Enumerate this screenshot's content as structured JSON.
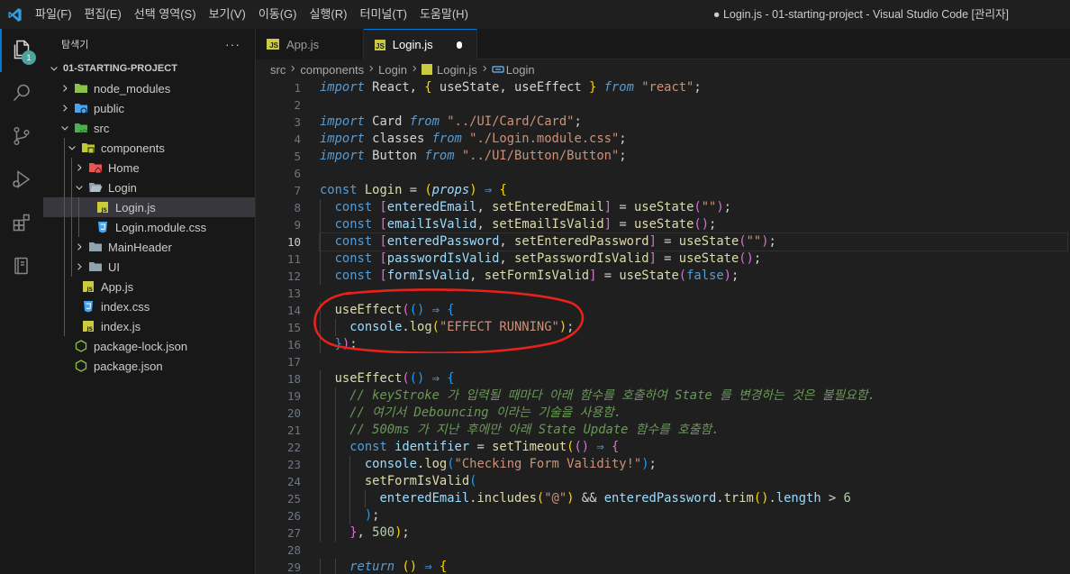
{
  "titlebar": {
    "menu": [
      "파일(F)",
      "편집(E)",
      "선택 영역(S)",
      "보기(V)",
      "이동(G)",
      "실행(R)",
      "터미널(T)",
      "도움말(H)"
    ],
    "window_title": "● Login.js - 01-starting-project - Visual Studio Code [관리자]"
  },
  "activity": {
    "explorer_badge": "1",
    "icons": [
      "files-icon",
      "search-icon",
      "source-control-icon",
      "run-debug-icon",
      "extensions-icon",
      "notebook-icon"
    ]
  },
  "sidebar": {
    "title": "탐색기",
    "more": "···",
    "project": "01-STARTING-PROJECT",
    "tree": [
      {
        "label": "node_modules",
        "type": "folder",
        "depth": 0,
        "open": false,
        "icon": "node-folder-icon"
      },
      {
        "label": "public",
        "type": "folder",
        "depth": 0,
        "open": false,
        "icon": "public-folder-icon"
      },
      {
        "label": "src",
        "type": "folder",
        "depth": 0,
        "open": true,
        "icon": "src-folder-icon"
      },
      {
        "label": "components",
        "type": "folder",
        "depth": 1,
        "open": true,
        "icon": "components-folder-icon"
      },
      {
        "label": "Home",
        "type": "folder",
        "depth": 2,
        "open": false,
        "icon": "home-folder-icon"
      },
      {
        "label": "Login",
        "type": "folder",
        "depth": 2,
        "open": true,
        "icon": "folder-icon"
      },
      {
        "label": "Login.js",
        "type": "js",
        "depth": 3,
        "selected": true,
        "icon": "js-file-icon"
      },
      {
        "label": "Login.module.css",
        "type": "css",
        "depth": 3,
        "icon": "css-file-icon"
      },
      {
        "label": "MainHeader",
        "type": "folder",
        "depth": 2,
        "open": false,
        "icon": "folder-icon"
      },
      {
        "label": "UI",
        "type": "folder",
        "depth": 2,
        "open": false,
        "icon": "folder-icon"
      },
      {
        "label": "App.js",
        "type": "js",
        "depth": 1,
        "icon": "js-file-icon"
      },
      {
        "label": "index.css",
        "type": "css",
        "depth": 1,
        "icon": "css-file-icon"
      },
      {
        "label": "index.js",
        "type": "js",
        "depth": 1,
        "icon": "js-file-icon"
      },
      {
        "label": "package-lock.json",
        "type": "node",
        "depth": 0,
        "icon": "npm-file-icon"
      },
      {
        "label": "package.json",
        "type": "node",
        "depth": 0,
        "icon": "npm-file-icon"
      }
    ]
  },
  "tabs": [
    {
      "label": "App.js",
      "active": false,
      "modified": false,
      "icon_text": "JS"
    },
    {
      "label": "Login.js",
      "active": true,
      "modified": true,
      "icon_text": "JS"
    }
  ],
  "breadcrumbs": [
    "src",
    "components",
    "Login",
    "Login.js",
    "Login"
  ],
  "editor": {
    "current_line": 10,
    "line_numbers": [
      "1",
      "2",
      "3",
      "4",
      "5",
      "6",
      "7",
      "8",
      "9",
      "10",
      "11",
      "12",
      "13",
      "14",
      "15",
      "16",
      "17",
      "18",
      "19",
      "20",
      "21",
      "22",
      "23",
      "24",
      "25",
      "26",
      "27",
      "28",
      "29"
    ],
    "lines": [
      [
        [
          "k",
          "import"
        ],
        [
          "w",
          " React, "
        ],
        [
          "b1",
          "{"
        ],
        [
          "w",
          " useState, useEffect "
        ],
        [
          "b1",
          "}"
        ],
        [
          "w",
          " "
        ],
        [
          "k",
          "from"
        ],
        [
          "w",
          " "
        ],
        [
          "s",
          "\"react\""
        ],
        [
          "w",
          ";"
        ]
      ],
      [],
      [
        [
          "k",
          "import"
        ],
        [
          "w",
          " Card "
        ],
        [
          "k",
          "from"
        ],
        [
          "w",
          " "
        ],
        [
          "s",
          "\"../UI/Card/Card\""
        ],
        [
          "w",
          ";"
        ]
      ],
      [
        [
          "k",
          "import"
        ],
        [
          "w",
          " classes "
        ],
        [
          "k",
          "from"
        ],
        [
          "w",
          " "
        ],
        [
          "s",
          "\"./Login.module.css\""
        ],
        [
          "w",
          ";"
        ]
      ],
      [
        [
          "k",
          "import"
        ],
        [
          "w",
          " Button "
        ],
        [
          "k",
          "from"
        ],
        [
          "w",
          " "
        ],
        [
          "s",
          "\"../UI/Button/Button\""
        ],
        [
          "w",
          ";"
        ]
      ],
      [],
      [
        [
          "c",
          "const"
        ],
        [
          "w",
          " "
        ],
        [
          "f",
          "Login"
        ],
        [
          "w",
          " = "
        ],
        [
          "b1",
          "("
        ],
        [
          "p",
          "props"
        ],
        [
          "b1",
          ")"
        ],
        [
          "w",
          " "
        ],
        [
          "c",
          "⇒"
        ],
        [
          "w",
          " "
        ],
        [
          "b1",
          "{"
        ]
      ],
      [
        [
          "w",
          "  "
        ],
        [
          "c",
          "const"
        ],
        [
          "w",
          " "
        ],
        [
          "b2",
          "["
        ],
        [
          "v",
          "enteredEmail"
        ],
        [
          "w",
          ", "
        ],
        [
          "f",
          "setEnteredEmail"
        ],
        [
          "b2",
          "]"
        ],
        [
          "w",
          " = "
        ],
        [
          "f",
          "useState"
        ],
        [
          "b2",
          "("
        ],
        [
          "s",
          "\"\""
        ],
        [
          "b2",
          ")"
        ],
        [
          "w",
          ";"
        ]
      ],
      [
        [
          "w",
          "  "
        ],
        [
          "c",
          "const"
        ],
        [
          "w",
          " "
        ],
        [
          "b2",
          "["
        ],
        [
          "v",
          "emailIsValid"
        ],
        [
          "w",
          ", "
        ],
        [
          "f",
          "setEmailIsValid"
        ],
        [
          "b2",
          "]"
        ],
        [
          "w",
          " = "
        ],
        [
          "f",
          "useState"
        ],
        [
          "b2",
          "()"
        ],
        [
          "w",
          ";"
        ]
      ],
      [
        [
          "w",
          "  "
        ],
        [
          "c",
          "const"
        ],
        [
          "w",
          " "
        ],
        [
          "b2",
          "["
        ],
        [
          "v",
          "enteredPassword"
        ],
        [
          "w",
          ", "
        ],
        [
          "f",
          "setEnteredPassword"
        ],
        [
          "b2",
          "]"
        ],
        [
          "w",
          " = "
        ],
        [
          "f",
          "useState"
        ],
        [
          "b2",
          "("
        ],
        [
          "s",
          "\"\""
        ],
        [
          "b2",
          ")"
        ],
        [
          "w",
          ";"
        ]
      ],
      [
        [
          "w",
          "  "
        ],
        [
          "c",
          "const"
        ],
        [
          "w",
          " "
        ],
        [
          "b2",
          "["
        ],
        [
          "v",
          "passwordIsValid"
        ],
        [
          "w",
          ", "
        ],
        [
          "f",
          "setPasswordIsValid"
        ],
        [
          "b2",
          "]"
        ],
        [
          "w",
          " = "
        ],
        [
          "f",
          "useState"
        ],
        [
          "b2",
          "()"
        ],
        [
          "w",
          ";"
        ]
      ],
      [
        [
          "w",
          "  "
        ],
        [
          "c",
          "const"
        ],
        [
          "w",
          " "
        ],
        [
          "b2",
          "["
        ],
        [
          "v",
          "formIsValid"
        ],
        [
          "w",
          ", "
        ],
        [
          "f",
          "setFormIsValid"
        ],
        [
          "b2",
          "]"
        ],
        [
          "w",
          " = "
        ],
        [
          "f",
          "useState"
        ],
        [
          "b2",
          "("
        ],
        [
          "c",
          "false"
        ],
        [
          "b2",
          ")"
        ],
        [
          "w",
          ";"
        ]
      ],
      [],
      [
        [
          "w",
          "  "
        ],
        [
          "f",
          "useEffect"
        ],
        [
          "b2",
          "("
        ],
        [
          "b3",
          "()"
        ],
        [
          "w",
          " "
        ],
        [
          "c",
          "⇒"
        ],
        [
          "w",
          " "
        ],
        [
          "b3",
          "{"
        ]
      ],
      [
        [
          "w",
          "    "
        ],
        [
          "v",
          "console"
        ],
        [
          "w",
          "."
        ],
        [
          "f",
          "log"
        ],
        [
          "b1",
          "("
        ],
        [
          "s",
          "\"EFFECT RUNNING\""
        ],
        [
          "b1",
          ")"
        ],
        [
          "w",
          ";"
        ]
      ],
      [
        [
          "w",
          "  "
        ],
        [
          "b3",
          "}"
        ],
        [
          "b2",
          ")"
        ],
        [
          "w",
          ";"
        ]
      ],
      [],
      [
        [
          "w",
          "  "
        ],
        [
          "f",
          "useEffect"
        ],
        [
          "b2",
          "("
        ],
        [
          "b3",
          "()"
        ],
        [
          "w",
          " "
        ],
        [
          "c",
          "⇒"
        ],
        [
          "w",
          " "
        ],
        [
          "b3",
          "{"
        ]
      ],
      [
        [
          "w",
          "    "
        ],
        [
          "com",
          "// keyStroke 가 입력될 때마다 아래 함수를 호출하여 State 를 변경하는 것은 불필요함."
        ]
      ],
      [
        [
          "w",
          "    "
        ],
        [
          "com",
          "// 여기서 Debouncing 이라는 기술을 사용함."
        ]
      ],
      [
        [
          "w",
          "    "
        ],
        [
          "com",
          "// 500ms 가 지난 후에만 아래 State Update 함수를 호출함."
        ]
      ],
      [
        [
          "w",
          "    "
        ],
        [
          "c",
          "const"
        ],
        [
          "w",
          " "
        ],
        [
          "v",
          "identifier"
        ],
        [
          "w",
          " = "
        ],
        [
          "f",
          "setTimeout"
        ],
        [
          "b1",
          "("
        ],
        [
          "b2",
          "()"
        ],
        [
          "w",
          " "
        ],
        [
          "c",
          "⇒"
        ],
        [
          "w",
          " "
        ],
        [
          "b2",
          "{"
        ]
      ],
      [
        [
          "w",
          "      "
        ],
        [
          "v",
          "console"
        ],
        [
          "w",
          "."
        ],
        [
          "f",
          "log"
        ],
        [
          "b3",
          "("
        ],
        [
          "s",
          "\"Checking Form Validity!\""
        ],
        [
          "b3",
          ")"
        ],
        [
          "w",
          ";"
        ]
      ],
      [
        [
          "w",
          "      "
        ],
        [
          "f",
          "setFormIsValid"
        ],
        [
          "b3",
          "("
        ]
      ],
      [
        [
          "w",
          "        "
        ],
        [
          "v",
          "enteredEmail"
        ],
        [
          "w",
          "."
        ],
        [
          "f",
          "includes"
        ],
        [
          "b1",
          "("
        ],
        [
          "s",
          "\"@\""
        ],
        [
          "b1",
          ")"
        ],
        [
          "w",
          " && "
        ],
        [
          "v",
          "enteredPassword"
        ],
        [
          "w",
          "."
        ],
        [
          "f",
          "trim"
        ],
        [
          "b1",
          "()"
        ],
        [
          "w",
          "."
        ],
        [
          "v",
          "length"
        ],
        [
          "w",
          " > "
        ],
        [
          "n",
          "6"
        ]
      ],
      [
        [
          "w",
          "      "
        ],
        [
          "b3",
          ")"
        ],
        [
          "w",
          ";"
        ]
      ],
      [
        [
          "w",
          "    "
        ],
        [
          "b2",
          "}"
        ],
        [
          "w",
          ", "
        ],
        [
          "n",
          "500"
        ],
        [
          "b1",
          ")"
        ],
        [
          "w",
          ";"
        ]
      ],
      [],
      [
        [
          "w",
          "    "
        ],
        [
          "k",
          "return"
        ],
        [
          "w",
          " "
        ],
        [
          "b1",
          "()"
        ],
        [
          "w",
          " "
        ],
        [
          "c",
          "⇒"
        ],
        [
          "w",
          " "
        ],
        [
          "b1",
          "{"
        ]
      ]
    ]
  }
}
